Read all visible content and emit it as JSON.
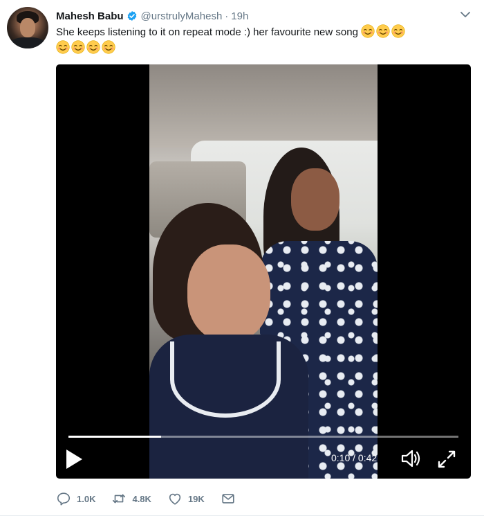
{
  "tweet": {
    "author_name": "Mahesh Babu",
    "handle": "@urstrulyMahesh",
    "separator": "·",
    "time": "19h",
    "text": "She keeps listening to it on repeat mode :) her favourite new song",
    "emojis_line1": [
      "😊",
      "😊",
      "😊"
    ],
    "emojis_line2": [
      "😊",
      "😊",
      "😊",
      "😊"
    ],
    "icons": {
      "avatar": "avatar-image",
      "verified": "verified-badge-icon",
      "menu": "chevron-down-icon"
    }
  },
  "video": {
    "timecode": "0:10 / 0:42",
    "progress": 0.238,
    "icons": {
      "play": "play-icon",
      "volume": "volume-icon",
      "fullscreen": "fullscreen-icon"
    }
  },
  "actions": {
    "reply": {
      "icon": "reply-icon",
      "count": "1.0K"
    },
    "retweet": {
      "icon": "retweet-icon",
      "count": "4.8K"
    },
    "like": {
      "icon": "heart-icon",
      "count": "19K"
    },
    "message": {
      "icon": "envelope-icon"
    }
  },
  "colors": {
    "text_primary": "#14171a",
    "text_secondary": "#657786",
    "verified_blue": "#1da1f2",
    "emoji_yellow": "#ffcc4d"
  }
}
